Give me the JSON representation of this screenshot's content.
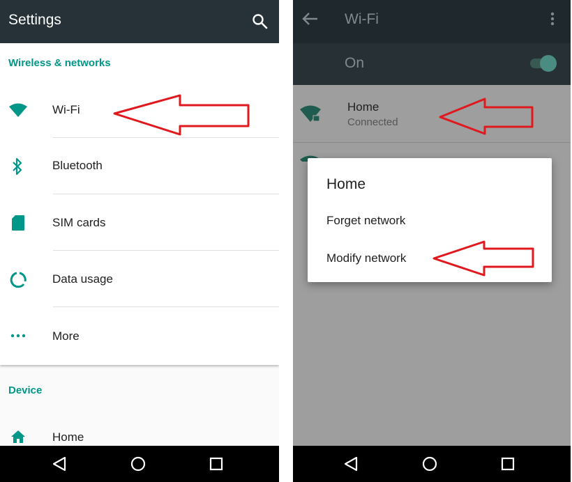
{
  "settings": {
    "title": "Settings",
    "wireless_header": "Wireless & networks",
    "items": [
      {
        "label": "Wi-Fi",
        "icon": "wifi-icon"
      },
      {
        "label": "Bluetooth",
        "icon": "bluetooth-icon"
      },
      {
        "label": "SIM cards",
        "icon": "sim-card-icon"
      },
      {
        "label": "Data usage",
        "icon": "data-usage-icon"
      },
      {
        "label": "More",
        "icon": "more-dots-icon"
      }
    ],
    "device_header": "Device",
    "device_items": [
      {
        "label": "Home",
        "icon": "home-icon"
      }
    ]
  },
  "wifi": {
    "title": "Wi-Fi",
    "toggle_label": "On",
    "toggle_on": true,
    "networks": [
      {
        "name": "Home",
        "status": "Connected"
      }
    ],
    "dialog": {
      "title": "Home",
      "options": [
        "Forget network",
        "Modify network"
      ]
    }
  },
  "colors": {
    "accent": "#009688",
    "appbar_dark": "#263238",
    "annotation_arrow": "#e0191f"
  }
}
